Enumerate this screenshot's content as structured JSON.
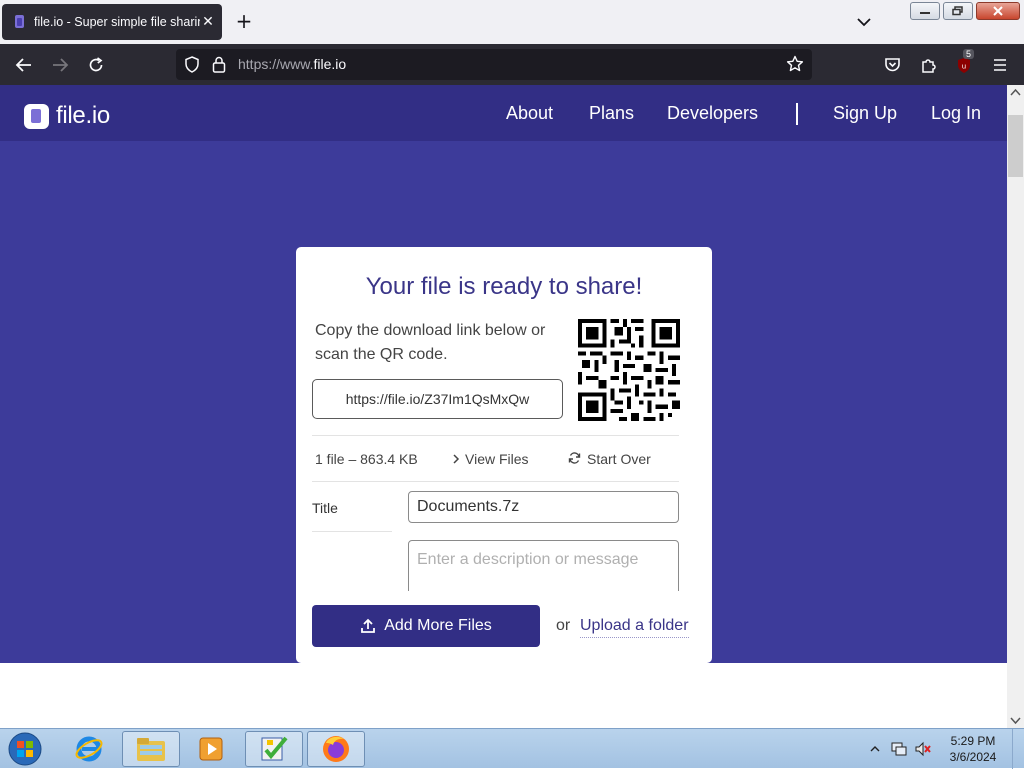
{
  "browser": {
    "tab_title": "file.io - Super simple file sharing",
    "url_prefix": "https://www.",
    "url_domain": "file.io",
    "extension_badge": "5"
  },
  "site": {
    "logo_text": "file.io",
    "nav": [
      "About",
      "Plans",
      "Developers",
      "Sign Up",
      "Log In"
    ]
  },
  "card": {
    "heading": "Your file is ready to share!",
    "instructions": "Copy the download link below or scan the QR code.",
    "share_link": "https://file.io/Z37Im1QsMxQw",
    "file_summary": "1 file – 863.4 KB",
    "view_files": "View Files",
    "start_over": "Start Over",
    "title_label": "Title",
    "title_value": "Documents.7z",
    "description_placeholder": "Enter a description or message",
    "add_more_files": "Add More Files",
    "or_text": "or",
    "upload_folder": "Upload a folder"
  },
  "taskbar": {
    "time": "5:29 PM",
    "date": "3/6/2024"
  },
  "colors": {
    "brand": "#322e85",
    "hero": "#3d3b9a",
    "heading": "#3a3588"
  }
}
